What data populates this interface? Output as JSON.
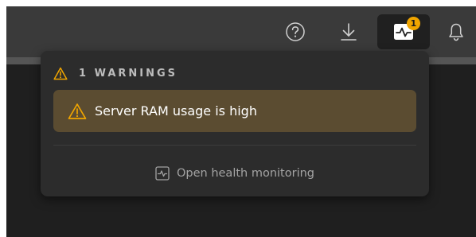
{
  "topbar": {
    "icons": {
      "help": "help-circle-icon",
      "download": "download-icon",
      "health": "heartbeat-icon",
      "notifications": "bell-icon"
    },
    "health_badge_count": "1",
    "badge_color": "#f0a500"
  },
  "popover": {
    "header_label": "1 WARNINGS",
    "warnings": [
      {
        "text": "Server RAM usage is high",
        "icon": "warning-triangle-icon"
      }
    ],
    "open_link_label": "Open health monitoring",
    "open_link_icon": "activity-square-icon"
  },
  "colors": {
    "warning_accent": "#f0a500",
    "warning_item_bg": "#5b4c31",
    "popover_bg": "#2c2c2c"
  }
}
